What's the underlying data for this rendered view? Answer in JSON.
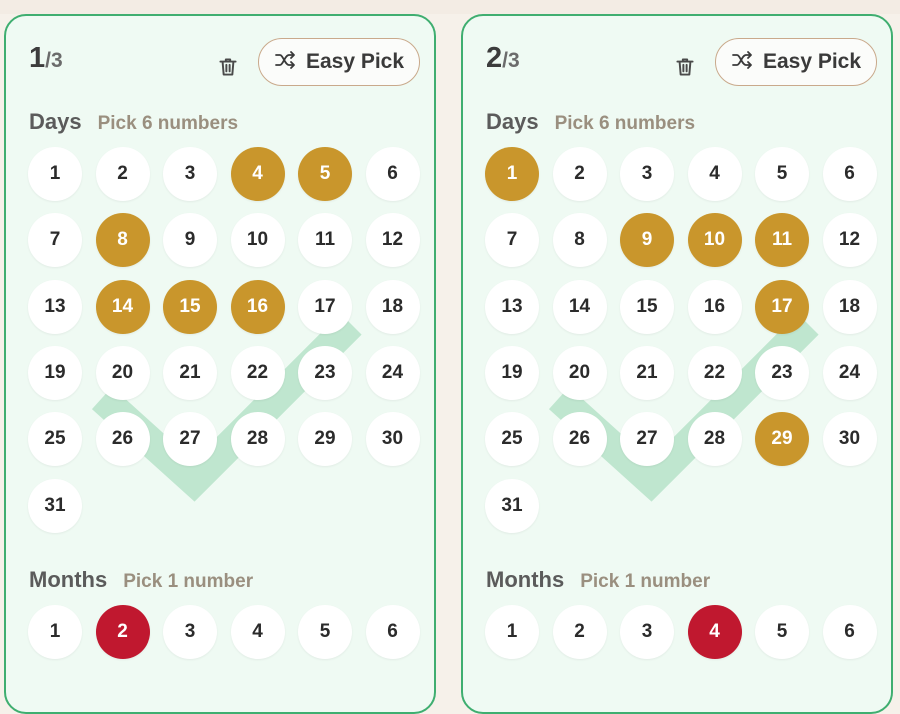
{
  "tickets": [
    {
      "index": "1",
      "total": "/3",
      "easy_pick_label": "Easy Pick",
      "days_heading": "Days",
      "days_hint": "Pick 6 numbers",
      "months_heading": "Months",
      "months_hint": "Pick 1 number",
      "days": [
        "1",
        "2",
        "3",
        "4",
        "5",
        "6",
        "7",
        "8",
        "9",
        "10",
        "11",
        "12",
        "13",
        "14",
        "15",
        "16",
        "17",
        "18",
        "19",
        "20",
        "21",
        "22",
        "23",
        "24",
        "25",
        "26",
        "27",
        "28",
        "29",
        "30",
        "31"
      ],
      "selected_days": [
        "4",
        "5",
        "8",
        "14",
        "15",
        "16"
      ],
      "months": [
        "1",
        "2",
        "3",
        "4",
        "5",
        "6"
      ],
      "selected_month": "2"
    },
    {
      "index": "2",
      "total": "/3",
      "easy_pick_label": "Easy Pick",
      "days_heading": "Days",
      "days_hint": "Pick 6 numbers",
      "months_heading": "Months",
      "months_hint": "Pick 1 number",
      "days": [
        "1",
        "2",
        "3",
        "4",
        "5",
        "6",
        "7",
        "8",
        "9",
        "10",
        "11",
        "12",
        "13",
        "14",
        "15",
        "16",
        "17",
        "18",
        "19",
        "20",
        "21",
        "22",
        "23",
        "24",
        "25",
        "26",
        "27",
        "28",
        "29",
        "30",
        "31"
      ],
      "selected_days": [
        "1",
        "9",
        "10",
        "11",
        "17",
        "29"
      ],
      "months": [
        "1",
        "2",
        "3",
        "4",
        "5",
        "6"
      ],
      "selected_month": "4"
    }
  ],
  "icons": {
    "delete": "trash-icon",
    "shuffle": "shuffle-icon",
    "watermark": "checkmark-icon"
  },
  "colors": {
    "card_border": "#3fae70",
    "card_bg": "#effaf3",
    "selected_day": "#c9962c",
    "selected_month": "#c0182f",
    "watermark": "#bfe6cf"
  }
}
